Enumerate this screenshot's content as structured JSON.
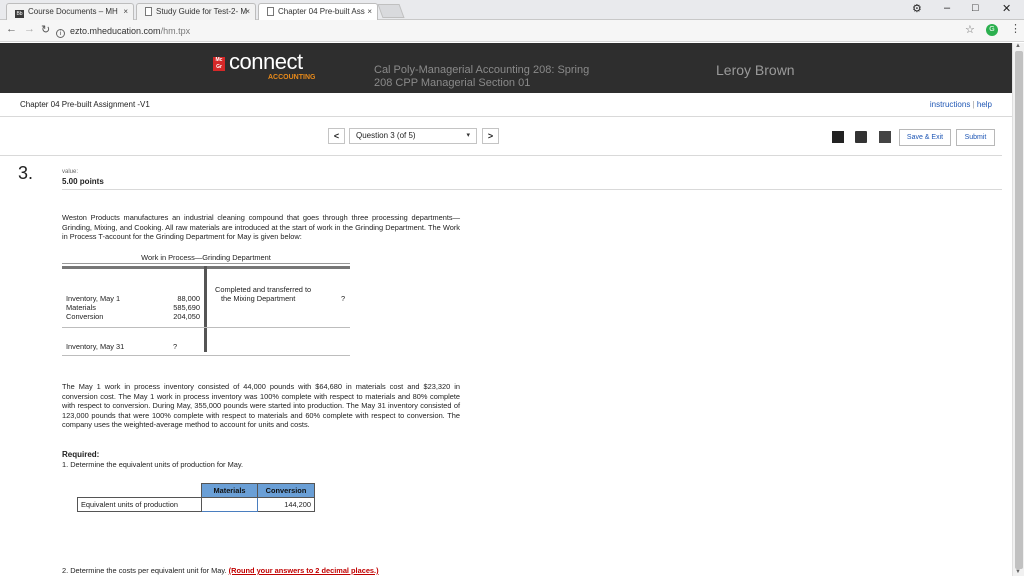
{
  "browser": {
    "tabs": [
      {
        "label": "Course Documents – MH",
        "icon": "blackboard-icon",
        "active": false
      },
      {
        "label": "Study Guide for Test-2- M",
        "icon": "document-icon",
        "active": false
      },
      {
        "label": "Chapter 04 Pre-built Ass",
        "icon": "document-icon",
        "active": true
      }
    ],
    "url_host": "ezto.mheducation.com",
    "url_path": "/hm.tpx",
    "tab_close_glyph": "×",
    "window_controls": {
      "profile": "⚙",
      "minimize": "–",
      "maximize": "□",
      "close": "✕"
    }
  },
  "header": {
    "logo": "connect",
    "logo_sub": "ACCOUNTING",
    "course_line1": "Cal Poly-Managerial Accounting 208: Spring",
    "course_line2": "208 CPP Managerial Section 01",
    "user_name": "Leroy Brown"
  },
  "assignment": {
    "title": "Chapter 04 Pre-built Assignment -V1",
    "instructions_link": "instructions",
    "separator": "|",
    "help_link": "help"
  },
  "question_nav": {
    "prev": "<",
    "next": ">",
    "current": "Question 3 (of 5)",
    "caret": "▾"
  },
  "actions": {
    "save_exit": "Save & Exit",
    "submit": "Submit"
  },
  "question": {
    "number": "3.",
    "value_label": "value:",
    "points": "5.00 points",
    "intro": "Weston Products manufactures an industrial cleaning compound that goes through three processing departments—Grinding, Mixing, and Cooking. All raw materials are introduced at the start of work in the Grinding Department. The Work in Process T-account for the Grinding Department for May is given below:",
    "t_account": {
      "title": "Work in Process—Grinding Department",
      "debit_labels": [
        "Inventory, May 1",
        "Materials",
        "Conversion"
      ],
      "debit_values": [
        "88,000",
        "585,690",
        "204,050"
      ],
      "credit_label_1": "Completed and transferred to",
      "credit_label_2": "the Mixing Department",
      "credit_value": "?",
      "ending_label": "Inventory, May 31",
      "ending_value": "?"
    },
    "details": "The May 1 work in process inventory consisted of 44,000 pounds with $64,680 in materials cost and $23,320 in conversion cost. The May 1 work in process inventory was 100% complete with respect to materials and 80% complete with respect to conversion. During May, 355,000 pounds were started into production. The May 31 inventory consisted of 123,000 pounds that were 100% complete with respect to materials and 60% complete with respect to conversion. The company uses the weighted-average method to account for units and costs.",
    "required_label": "Required:",
    "req1": "1. Determine the equivalent units of production for May.",
    "table": {
      "col_materials": "Materials",
      "col_conversion": "Conversion",
      "row_label": "Equivalent units of production",
      "materials_value": "",
      "conversion_value": "144,200"
    },
    "req2_prefix": "2. Determine the costs per equivalent unit for May.",
    "req2_warning": "(Round your answers to 2 decimal places.)"
  },
  "colors": {
    "header_bg": "#2e2e2e",
    "accent_red": "#d62828",
    "accent_orange": "#e88a1a",
    "link_blue": "#1f57b5",
    "table_header_blue": "#6a9fd6"
  }
}
